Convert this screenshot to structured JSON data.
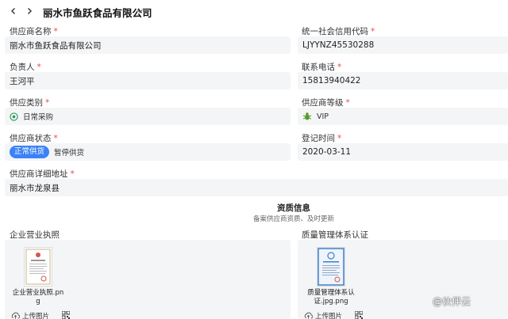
{
  "header": {
    "title": "丽水市鱼跃食品有限公司"
  },
  "fields": {
    "name": {
      "label": "供应商名称",
      "value": "丽水市鱼跃食品有限公司"
    },
    "credit_code": {
      "label": "统一社会信用代码",
      "value": "LJYYNZ45530288"
    },
    "owner": {
      "label": "负责人",
      "value": "王河平"
    },
    "phone": {
      "label": "联系电话",
      "value": "15813940422"
    },
    "category": {
      "label": "供应类别",
      "value": "日常采购"
    },
    "level": {
      "label": "供应商等级",
      "value": "VIP"
    },
    "status": {
      "label": "供应商状态",
      "active": "正常供货",
      "inactive": "暂停供货"
    },
    "reg_time": {
      "label": "登记时间",
      "value": "2020-03-11"
    },
    "address": {
      "label": "供应商详细地址",
      "value": "丽水市龙泉县"
    }
  },
  "section": {
    "title": "资质信息",
    "subtitle": "备案供应商资质、及时更新"
  },
  "uploads": {
    "license": {
      "label": "企业营业执照",
      "file_name": "企业营业执照.pn\ng",
      "button": "上传图片"
    },
    "quality": {
      "label": "质量管理体系认证",
      "file_name": "质量管理体系认\n证.jpg.png",
      "button": "上传图片"
    }
  },
  "required_mark": "*",
  "watermark": "@伙伴云",
  "colors": {
    "accent": "#3b82f6",
    "required": "#e34d4d",
    "field_bg": "#f4f5f7",
    "level_icon": "#5a9a2a",
    "category_icon": "#2f9d5e"
  }
}
